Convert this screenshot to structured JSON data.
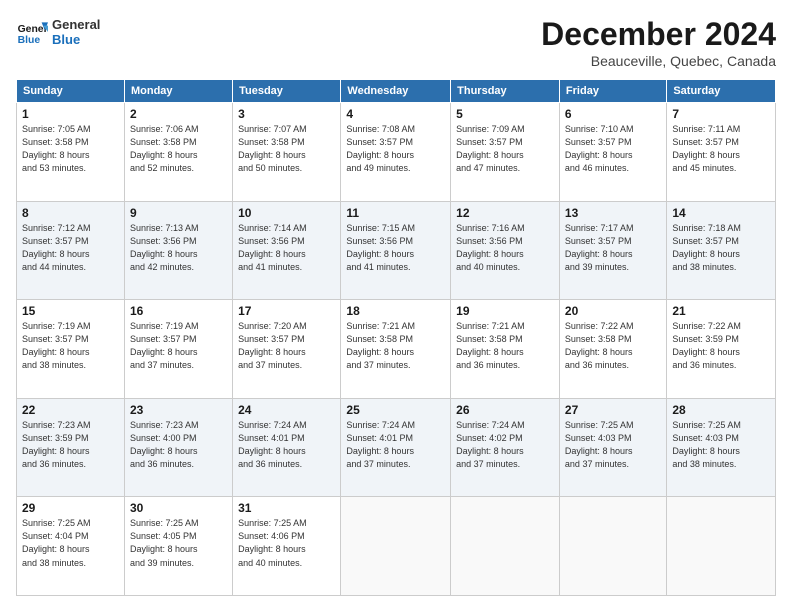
{
  "logo": {
    "line1": "General",
    "line2": "Blue"
  },
  "title": "December 2024",
  "subtitle": "Beauceville, Quebec, Canada",
  "headers": [
    "Sunday",
    "Monday",
    "Tuesday",
    "Wednesday",
    "Thursday",
    "Friday",
    "Saturday"
  ],
  "weeks": [
    [
      {
        "day": "1",
        "sunrise": "7:05 AM",
        "sunset": "3:58 PM",
        "daylight": "8 hours and 53 minutes."
      },
      {
        "day": "2",
        "sunrise": "7:06 AM",
        "sunset": "3:58 PM",
        "daylight": "8 hours and 52 minutes."
      },
      {
        "day": "3",
        "sunrise": "7:07 AM",
        "sunset": "3:58 PM",
        "daylight": "8 hours and 50 minutes."
      },
      {
        "day": "4",
        "sunrise": "7:08 AM",
        "sunset": "3:57 PM",
        "daylight": "8 hours and 49 minutes."
      },
      {
        "day": "5",
        "sunrise": "7:09 AM",
        "sunset": "3:57 PM",
        "daylight": "8 hours and 47 minutes."
      },
      {
        "day": "6",
        "sunrise": "7:10 AM",
        "sunset": "3:57 PM",
        "daylight": "8 hours and 46 minutes."
      },
      {
        "day": "7",
        "sunrise": "7:11 AM",
        "sunset": "3:57 PM",
        "daylight": "8 hours and 45 minutes."
      }
    ],
    [
      {
        "day": "8",
        "sunrise": "7:12 AM",
        "sunset": "3:57 PM",
        "daylight": "8 hours and 44 minutes."
      },
      {
        "day": "9",
        "sunrise": "7:13 AM",
        "sunset": "3:56 PM",
        "daylight": "8 hours and 42 minutes."
      },
      {
        "day": "10",
        "sunrise": "7:14 AM",
        "sunset": "3:56 PM",
        "daylight": "8 hours and 41 minutes."
      },
      {
        "day": "11",
        "sunrise": "7:15 AM",
        "sunset": "3:56 PM",
        "daylight": "8 hours and 41 minutes."
      },
      {
        "day": "12",
        "sunrise": "7:16 AM",
        "sunset": "3:56 PM",
        "daylight": "8 hours and 40 minutes."
      },
      {
        "day": "13",
        "sunrise": "7:17 AM",
        "sunset": "3:57 PM",
        "daylight": "8 hours and 39 minutes."
      },
      {
        "day": "14",
        "sunrise": "7:18 AM",
        "sunset": "3:57 PM",
        "daylight": "8 hours and 38 minutes."
      }
    ],
    [
      {
        "day": "15",
        "sunrise": "7:19 AM",
        "sunset": "3:57 PM",
        "daylight": "8 hours and 38 minutes."
      },
      {
        "day": "16",
        "sunrise": "7:19 AM",
        "sunset": "3:57 PM",
        "daylight": "8 hours and 37 minutes."
      },
      {
        "day": "17",
        "sunrise": "7:20 AM",
        "sunset": "3:57 PM",
        "daylight": "8 hours and 37 minutes."
      },
      {
        "day": "18",
        "sunrise": "7:21 AM",
        "sunset": "3:58 PM",
        "daylight": "8 hours and 37 minutes."
      },
      {
        "day": "19",
        "sunrise": "7:21 AM",
        "sunset": "3:58 PM",
        "daylight": "8 hours and 36 minutes."
      },
      {
        "day": "20",
        "sunrise": "7:22 AM",
        "sunset": "3:58 PM",
        "daylight": "8 hours and 36 minutes."
      },
      {
        "day": "21",
        "sunrise": "7:22 AM",
        "sunset": "3:59 PM",
        "daylight": "8 hours and 36 minutes."
      }
    ],
    [
      {
        "day": "22",
        "sunrise": "7:23 AM",
        "sunset": "3:59 PM",
        "daylight": "8 hours and 36 minutes."
      },
      {
        "day": "23",
        "sunrise": "7:23 AM",
        "sunset": "4:00 PM",
        "daylight": "8 hours and 36 minutes."
      },
      {
        "day": "24",
        "sunrise": "7:24 AM",
        "sunset": "4:01 PM",
        "daylight": "8 hours and 36 minutes."
      },
      {
        "day": "25",
        "sunrise": "7:24 AM",
        "sunset": "4:01 PM",
        "daylight": "8 hours and 37 minutes."
      },
      {
        "day": "26",
        "sunrise": "7:24 AM",
        "sunset": "4:02 PM",
        "daylight": "8 hours and 37 minutes."
      },
      {
        "day": "27",
        "sunrise": "7:25 AM",
        "sunset": "4:03 PM",
        "daylight": "8 hours and 37 minutes."
      },
      {
        "day": "28",
        "sunrise": "7:25 AM",
        "sunset": "4:03 PM",
        "daylight": "8 hours and 38 minutes."
      }
    ],
    [
      {
        "day": "29",
        "sunrise": "7:25 AM",
        "sunset": "4:04 PM",
        "daylight": "8 hours and 38 minutes."
      },
      {
        "day": "30",
        "sunrise": "7:25 AM",
        "sunset": "4:05 PM",
        "daylight": "8 hours and 39 minutes."
      },
      {
        "day": "31",
        "sunrise": "7:25 AM",
        "sunset": "4:06 PM",
        "daylight": "8 hours and 40 minutes."
      },
      null,
      null,
      null,
      null
    ]
  ],
  "labels": {
    "sunrise": "Sunrise:",
    "sunset": "Sunset:",
    "daylight": "Daylight:"
  }
}
